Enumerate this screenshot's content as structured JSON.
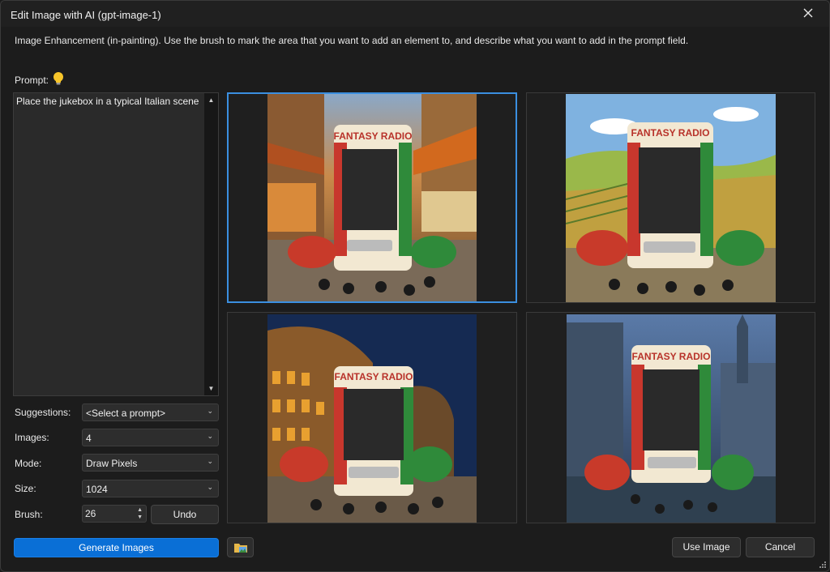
{
  "window": {
    "title": "Edit Image with AI (gpt-image-1)"
  },
  "description": "Image Enhancement (in-painting). Use the brush to mark the area that you want to add an element to, and describe what you want to add in the prompt field.",
  "prompt": {
    "label": "Prompt:",
    "value": "Place the jukebox in a typical Italian scene"
  },
  "fields": {
    "suggestions": {
      "label": "Suggestions:",
      "value": "<Select a prompt>"
    },
    "images": {
      "label": "Images:",
      "value": "4"
    },
    "mode": {
      "label": "Mode:",
      "value": "Draw Pixels"
    },
    "size": {
      "label": "Size:",
      "value": "1024"
    },
    "brush": {
      "label": "Brush:",
      "value": "26"
    }
  },
  "buttons": {
    "undo": "Undo",
    "generate": "Generate Images",
    "use_image": "Use Image",
    "cancel": "Cancel"
  },
  "gallery": {
    "selected_index": 0,
    "images": [
      {
        "scene": "italian-market",
        "sign": "FANTASY RADIO"
      },
      {
        "scene": "tuscan-countryside",
        "sign": "FANTASY RADIO"
      },
      {
        "scene": "colosseum-night",
        "sign": "FANTASY RADIO"
      },
      {
        "scene": "venice-dusk",
        "sign": "FANTASY RADIO"
      }
    ]
  },
  "colors": {
    "accent": "#0a6fd6",
    "selection": "#3b8fe0"
  }
}
